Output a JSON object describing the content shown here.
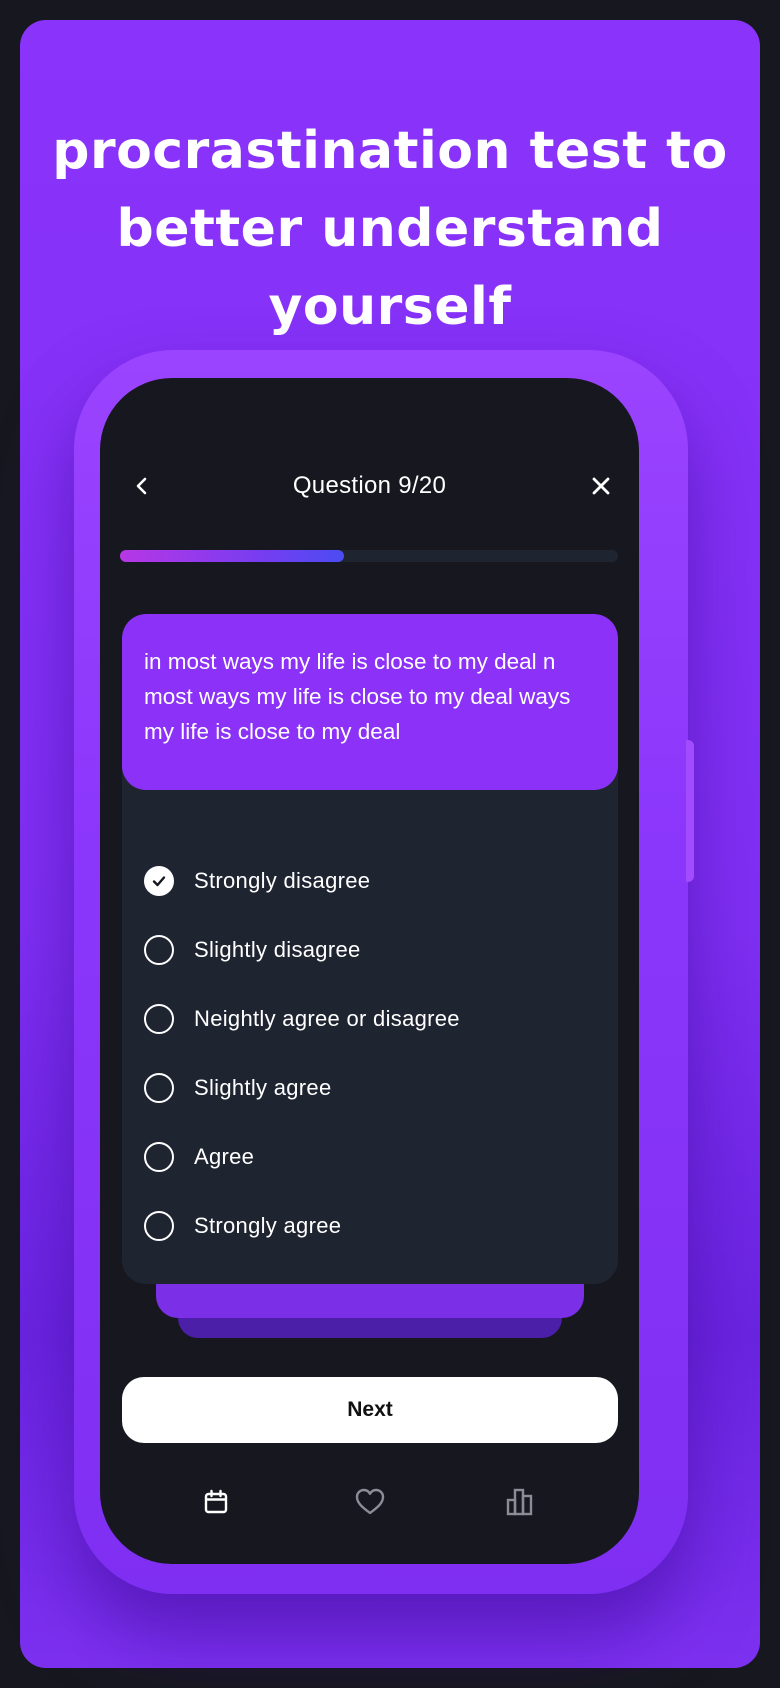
{
  "headline": {
    "line1": "procrastination test to",
    "line2": "better understand",
    "line3": "yourself"
  },
  "quiz": {
    "title": "Question 9/20",
    "progress_fraction": 0.45,
    "question_text": "in most ways my life is close to my deal n most ways my life is close to my deal ways my life is close to my deal",
    "options": [
      {
        "label": "Strongly disagree",
        "selected": true
      },
      {
        "label": "Slightly disagree",
        "selected": false
      },
      {
        "label": "Neightly agree or disagree",
        "selected": false
      },
      {
        "label": "Slightly agree",
        "selected": false
      },
      {
        "label": "Agree",
        "selected": false
      },
      {
        "label": "Strongly agree",
        "selected": false
      }
    ],
    "next_label": "Next"
  },
  "tabbar": {
    "items": [
      {
        "icon": "calendar-icon",
        "active": true
      },
      {
        "icon": "heart-icon",
        "active": false
      },
      {
        "icon": "bar-chart-icon",
        "active": false
      }
    ]
  },
  "colors": {
    "background": "#8a33fb",
    "screen": "#17181f",
    "card": "#1f2431",
    "question_card": "#8b31f8",
    "progress_start": "#b737e6",
    "progress_end": "#4b4cf3"
  }
}
